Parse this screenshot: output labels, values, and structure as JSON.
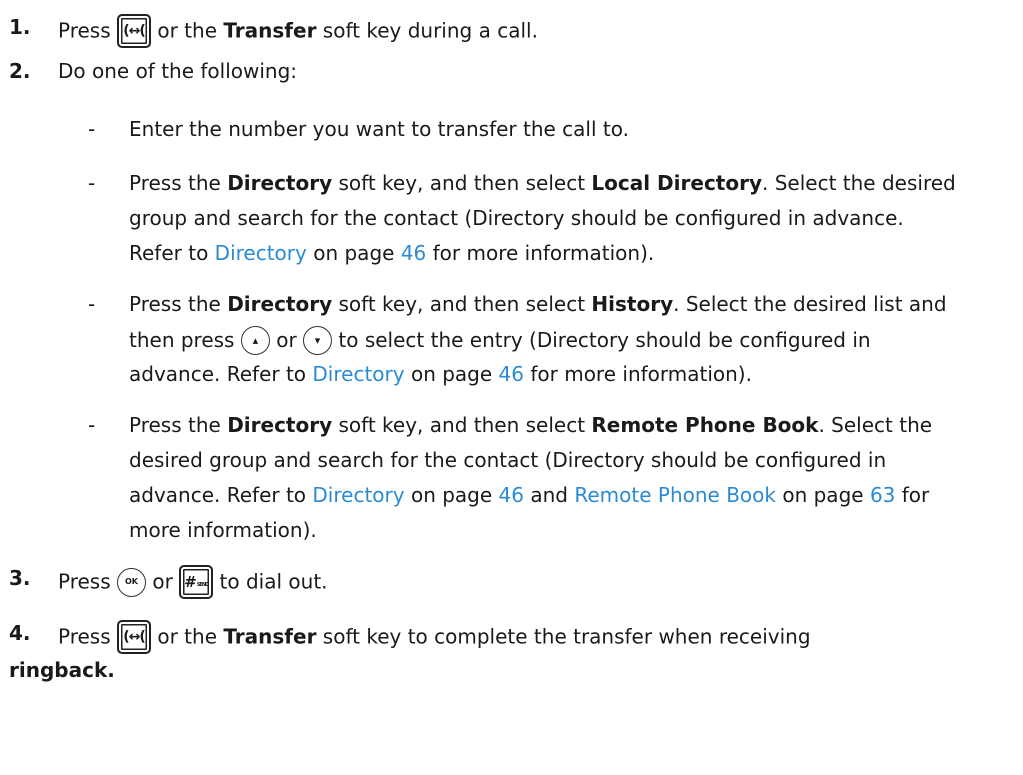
{
  "steps": [
    {
      "num": "1.",
      "a": "Press",
      "b": "or the",
      "c": "Transfer",
      "d": "soft key during a call."
    },
    {
      "num": "2.",
      "text": "Do one of the following:"
    }
  ],
  "bullets": {
    "dash": "-",
    "b1": {
      "text": "Enter the number you want to transfer the call to."
    },
    "b2": {
      "l1a": "Press the",
      "l1b": "Directory",
      "l1c": "soft key, and then select",
      "l1d": "Local Directory",
      "l1e": ". Select the desired",
      "l2": "group and search for the contact (Directory should be configured in advance.",
      "l3a": "Refer to",
      "l3b": "Directory",
      "l3c": "on page",
      "l3d": "46",
      "l3e": "for more information)."
    },
    "b3": {
      "l1a": "Press the",
      "l1b": "Directory",
      "l1c": "soft key, and then select",
      "l1d": "History",
      "l1e": ". Select the desired list and",
      "l2a": "then press",
      "l2b": "or",
      "l2c": "to select the entry (Directory should be configured in",
      "l3a": "advance. Refer to",
      "l3b": "Directory",
      "l3c": "on page",
      "l3d": "46",
      "l3e": "for more information)."
    },
    "b4": {
      "l1a": "Press the",
      "l1b": "Directory",
      "l1c": "soft key, and then select",
      "l1d": "Remote Phone Book",
      "l1e": ". Select the",
      "l2": "desired group and search for the contact (Directory should be configured in",
      "l3a": "advance. Refer to",
      "l3b": "Directory",
      "l3c": "on page",
      "l3d": "46",
      "l3e": "and",
      "l3f": "Remote Phone Book",
      "l3g": "on page",
      "l3h": "63",
      "l3i": "for",
      "l4": "more information)."
    }
  },
  "step3": {
    "num": "3.",
    "a": "Press",
    "b": "or",
    "c": "to dial out."
  },
  "step4": {
    "num": "4.",
    "a": "Press",
    "b": "or the",
    "c": "Transfer",
    "d": "soft key to complete the transfer when receiving",
    "e": "ringback."
  },
  "keys": {
    "transfer_glyph": "(↔(",
    "up_glyph": "▴",
    "down_glyph": "▾",
    "ok_label": "OK",
    "pound_glyph": "#",
    "send_label": "SEND"
  },
  "colors": {
    "link": "#2a8bd4",
    "text": "#1a1a1a"
  }
}
